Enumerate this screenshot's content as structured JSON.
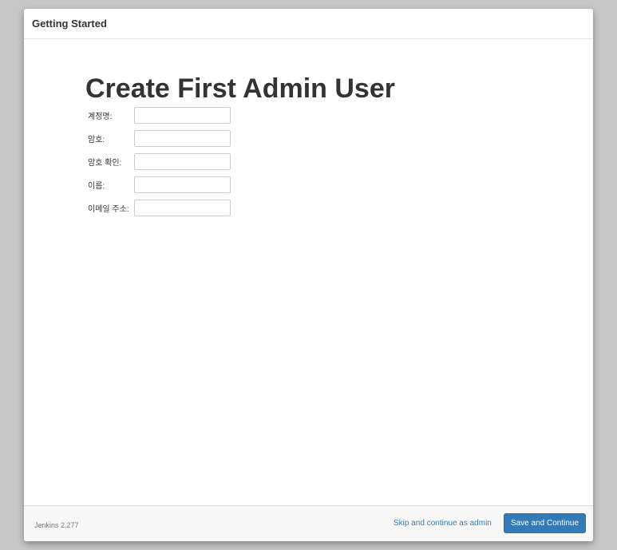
{
  "dialog": {
    "title": "Getting Started"
  },
  "page": {
    "heading": "Create First Admin User"
  },
  "form": {
    "fields": [
      {
        "label": "계정명:",
        "value": "",
        "placeholder": ""
      },
      {
        "label": "암호:",
        "value": "",
        "placeholder": ""
      },
      {
        "label": "암호 확인:",
        "value": "",
        "placeholder": ""
      },
      {
        "label": "이름:",
        "value": "",
        "placeholder": ""
      },
      {
        "label": "이메일 주소:",
        "value": "",
        "placeholder": ""
      }
    ]
  },
  "footer": {
    "version": "Jenkins 2.277",
    "skip_label": "Skip and continue as admin",
    "save_label": "Save and Continue"
  },
  "colors": {
    "primary": "#337ab7",
    "backdrop": "#c7c7c7"
  }
}
